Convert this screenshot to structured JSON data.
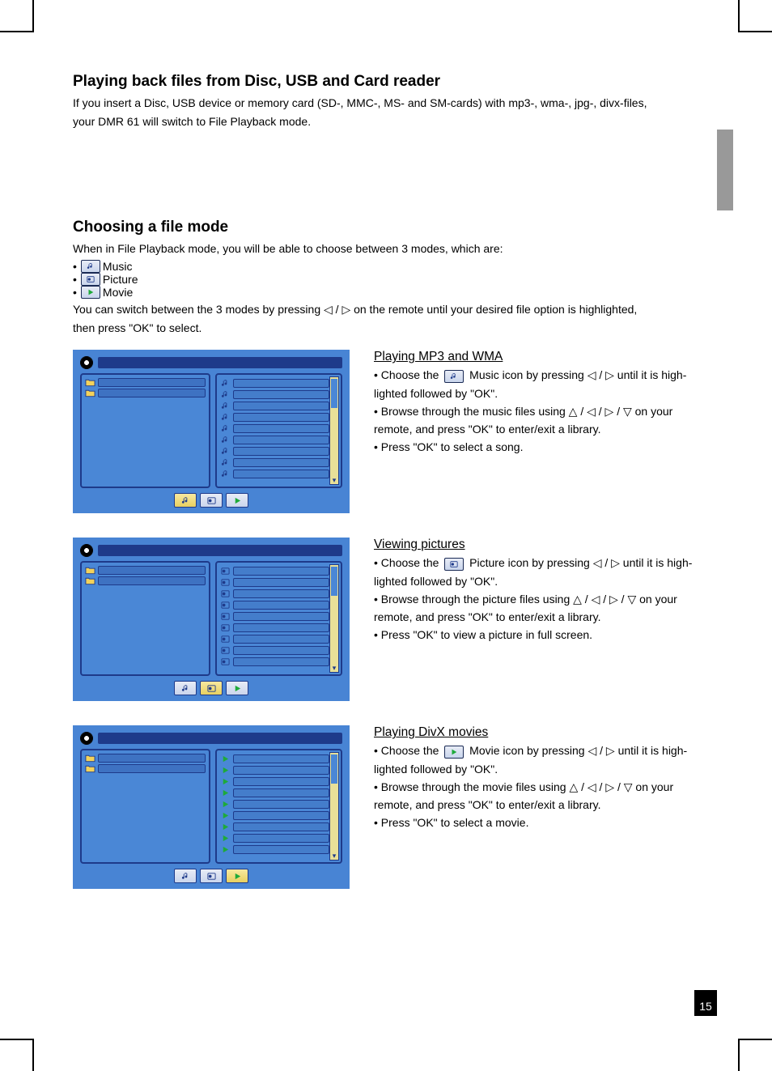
{
  "page_number": "15",
  "section1": {
    "title": "Playing back files from Disc, USB and Card reader",
    "line1": "If you insert a Disc, USB device or memory card (SD-, MMC-, MS- and SM-cards) with mp3-, wma-, jpg-, divx-files,",
    "line2": "your DMR 61 will switch to File Playback mode."
  },
  "section2": {
    "title": "Choosing a file mode",
    "intro": "When in File Playback mode, you will be able to choose between 3 modes, which are:",
    "modes": {
      "music": "Music",
      "picture": "Picture",
      "movie": "Movie"
    },
    "switch1": "You can switch between the 3  modes by pressing ◁ / ▷ on the remote until your desired file option is highlighted,",
    "switch2": "then press \"OK\" to select."
  },
  "mp3": {
    "title": "Playing MP3 and WMA",
    "l1a": "• Choose the ",
    "l1b": " Music icon by pressing ◁ / ▷ until it is high-",
    "l2": "lighted followed by \"OK\".",
    "l3": "• Browse through the music files using △ / ◁ / ▷ / ▽ on your",
    "l4": "remote, and press \"OK\" to enter/exit a library.",
    "l5": "• Press \"OK\" to select a song."
  },
  "pic": {
    "title": "Viewing pictures",
    "l1a": "• Choose the ",
    "l1b": " Picture icon by pressing ◁ / ▷ until it is high-",
    "l2": "lighted followed by \"OK\".",
    "l3": "• Browse through the picture files using △ / ◁ / ▷ / ▽ on your",
    "l4": "remote, and press \"OK\" to enter/exit a library.",
    "l5": "• Press \"OK\" to view a picture in full screen."
  },
  "mov": {
    "title": "Playing DivX movies",
    "l1a": "• Choose the ",
    "l1b": " Movie icon by pressing ◁ / ▷ until it is high-",
    "l2": "lighted followed by \"OK\".",
    "l3": "• Browse through the movie files using △ / ◁ / ▷ / ▽ on your",
    "l4": "remote, and press \"OK\" to enter/exit a library.",
    "l5": "• Press \"OK\" to select a movie."
  }
}
